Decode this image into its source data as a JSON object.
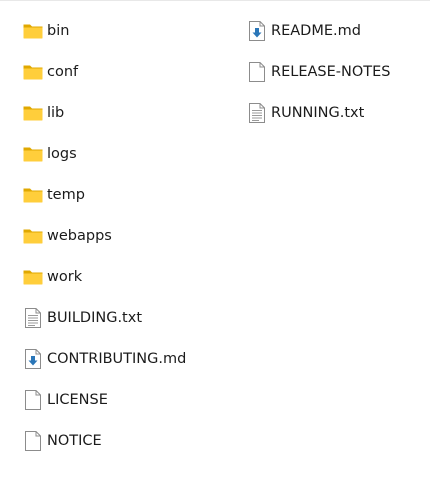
{
  "colors": {
    "folder_back": "#e0a800",
    "folder_front": "#ffce3b",
    "doc_outline": "#8c8c8c",
    "doc_lines": "#9a9a9a",
    "markdown_arrow": "#2a76b8"
  },
  "files_left": [
    {
      "name": "bin",
      "icon": "folder-icon"
    },
    {
      "name": "conf",
      "icon": "folder-icon"
    },
    {
      "name": "lib",
      "icon": "folder-icon"
    },
    {
      "name": "logs",
      "icon": "folder-icon"
    },
    {
      "name": "temp",
      "icon": "folder-icon"
    },
    {
      "name": "webapps",
      "icon": "folder-icon"
    },
    {
      "name": "work",
      "icon": "folder-icon"
    },
    {
      "name": "BUILDING.txt",
      "icon": "text-file-icon"
    },
    {
      "name": "CONTRIBUTING.md",
      "icon": "markdown-file-icon"
    },
    {
      "name": "LICENSE",
      "icon": "blank-file-icon"
    },
    {
      "name": "NOTICE",
      "icon": "blank-file-icon"
    }
  ],
  "files_right": [
    {
      "name": "README.md",
      "icon": "markdown-file-icon"
    },
    {
      "name": "RELEASE-NOTES",
      "icon": "blank-file-icon"
    },
    {
      "name": "RUNNING.txt",
      "icon": "text-file-icon"
    }
  ]
}
